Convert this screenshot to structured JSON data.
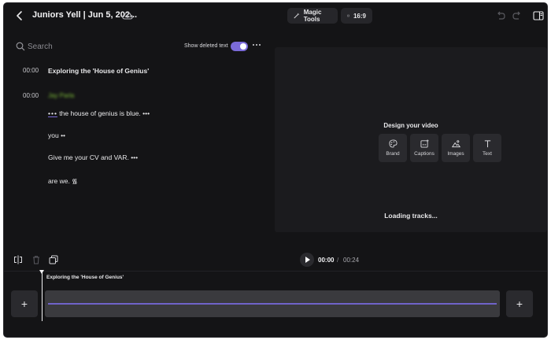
{
  "header": {
    "title": "Juniors Yell | Jun 5, 202...",
    "magic_tools": "Magic Tools",
    "aspect_ratio": "16:9"
  },
  "transcript": {
    "search_placeholder": "Search",
    "show_deleted_label": "Show deleted text",
    "show_deleted_on": true,
    "blocks": [
      {
        "time": "00:00",
        "text": "Exploring the 'House of Genius'"
      },
      {
        "time": "00:00",
        "speaker": "Jay Parla"
      }
    ],
    "lines": [
      {
        "lead": "•••",
        "text": " the house of genius is blue. •••"
      },
      {
        "text": "you ••"
      },
      {
        "text": "Give me your CV and VAR. •••"
      },
      {
        "text": "are we. ᯾"
      }
    ]
  },
  "preview": {
    "design_title": "Design your video",
    "tools": [
      "Brand",
      "Captions",
      "Images",
      "Text"
    ],
    "loading": "Loading tracks..."
  },
  "player": {
    "current": "00:00",
    "separator": "/",
    "total": "00:24"
  },
  "timeline": {
    "clip_title": "Exploring the 'House of Genius'",
    "add_label": "+"
  },
  "colors": {
    "accent": "#7b6bd9",
    "background": "#141416",
    "speaker": "#7fbf3a"
  }
}
